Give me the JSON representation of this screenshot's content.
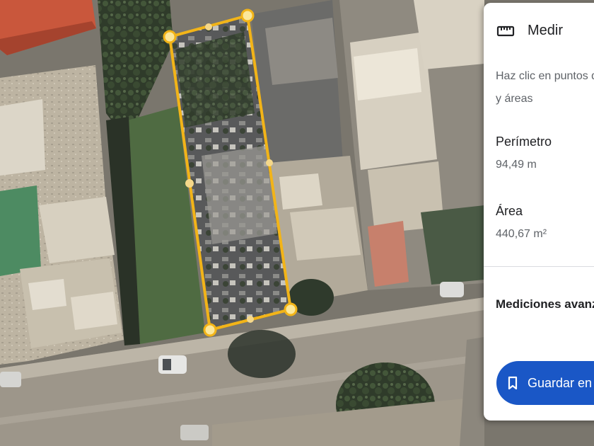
{
  "map": {
    "measure_polygon_color": "#f2b418",
    "view": "satellite"
  },
  "panel": {
    "title": "Medir",
    "title_icon": "ruler-icon",
    "instruction_line1": "Haz clic en puntos d",
    "instruction_line2": "y áreas",
    "perimeter_label": "Perímetro",
    "perimeter_value": "94,49 m",
    "area_label": "Área",
    "area_value": "440,67 m²",
    "advanced_label": "Mediciones avanza",
    "save_button": {
      "label": "Guardar en p",
      "icon": "bookmark-icon",
      "color": "#1a57c6"
    }
  }
}
